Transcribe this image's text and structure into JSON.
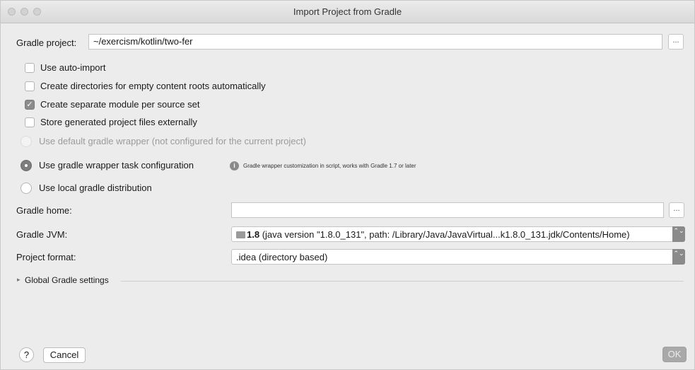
{
  "window": {
    "title": "Import Project from Gradle"
  },
  "gradle_project": {
    "label": "Gradle project:",
    "value": "~/exercism/kotlin/two-fer",
    "browse_label": "..."
  },
  "options": {
    "use_auto_import": {
      "label": "Use auto-import",
      "checked": false
    },
    "create_directories": {
      "label": "Create directories for empty content roots automatically",
      "checked": false
    },
    "separate_module": {
      "label": "Create separate module per source set",
      "checked": true,
      "mark": "✓"
    },
    "store_external": {
      "label": "Store generated project files externally",
      "checked": false
    }
  },
  "wrapper": {
    "default_label": "Use default gradle wrapper (not configured for the current project)",
    "task_config_label": "Use gradle wrapper task configuration",
    "task_config_hint": "Gradle wrapper customization in script, works with Gradle 1.7 or later",
    "info_glyph": "i",
    "local_label": "Use local gradle distribution",
    "selected": "task_config"
  },
  "gradle_home": {
    "label": "Gradle home:",
    "value": "",
    "browse_label": "..."
  },
  "gradle_jvm": {
    "label": "Gradle JVM:",
    "version": "1.8",
    "detail": " (java version \"1.8.0_131\", path: /Library/Java/JavaVirtual...k1.8.0_131.jdk/Contents/Home)"
  },
  "project_format": {
    "label": "Project format:",
    "value": ".idea (directory based)"
  },
  "global_settings": {
    "label": "Global Gradle settings",
    "expand_glyph": "▸"
  },
  "footer": {
    "help_label": "?",
    "cancel_label": "Cancel",
    "ok_label": "OK"
  },
  "combo_arrow_glyph": "⌃⌄"
}
